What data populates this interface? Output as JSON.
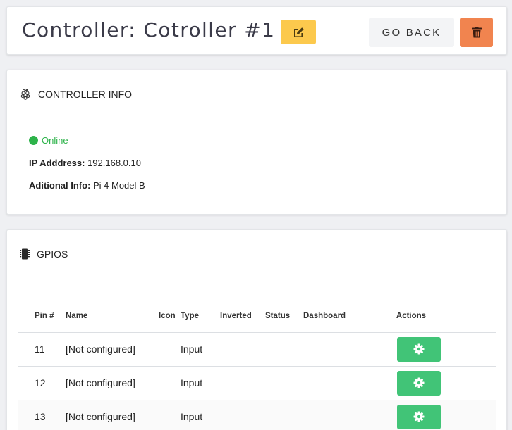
{
  "header": {
    "title": "Controller: Cotroller #1",
    "back_label": "GO BACK",
    "colors": {
      "edit": "#fcc94d",
      "delete": "#f1844f"
    }
  },
  "info": {
    "section_title": "CONTROLLER INFO",
    "status": "Online",
    "ip_label": "IP Adddress:",
    "ip_value": "192.168.0.10",
    "additional_label": "Aditional Info:",
    "additional_value": "Pi 4 Model B",
    "status_color": "#2db34a"
  },
  "gpios": {
    "section_title": "GPIOS",
    "columns": [
      "Pin #",
      "Name",
      "Icon",
      "Type",
      "Inverted",
      "Status",
      "Dashboard",
      "Actions"
    ],
    "rows": [
      {
        "pin": "11",
        "name": "[Not configured]",
        "icon": "",
        "type": "Input",
        "inverted": "",
        "status": "",
        "dashboard": ""
      },
      {
        "pin": "12",
        "name": "[Not configured]",
        "icon": "",
        "type": "Input",
        "inverted": "",
        "status": "",
        "dashboard": ""
      },
      {
        "pin": "13",
        "name": "[Not configured]",
        "icon": "",
        "type": "Input",
        "inverted": "",
        "status": "",
        "dashboard": ""
      }
    ],
    "action_color": "#41c477"
  }
}
